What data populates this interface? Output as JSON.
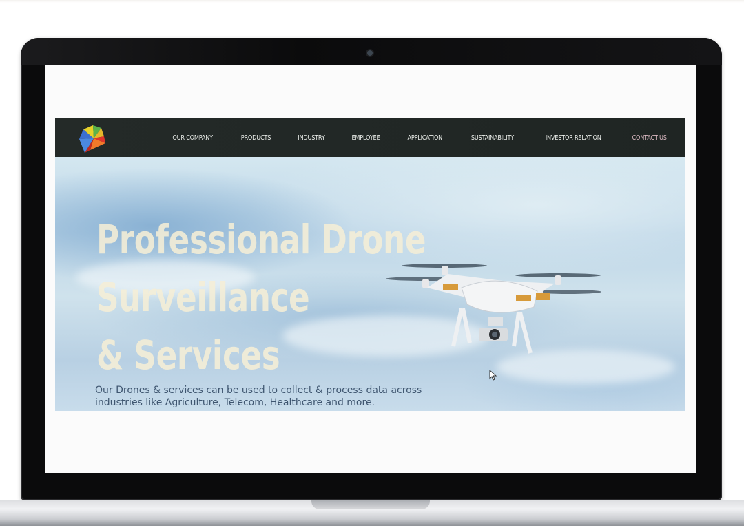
{
  "device": {
    "type": "laptop",
    "bezel_color": "#0b0b0c",
    "base_color": "#c9cbcf"
  },
  "website": {
    "logo_icon": "pinwheel-logo-icon",
    "nav": {
      "items": [
        {
          "label": "OUR COMPANY"
        },
        {
          "label": "PRODUCTS"
        },
        {
          "label": "INDUSTRY"
        },
        {
          "label": "EMPLOYEE"
        },
        {
          "label": "APPLICATION"
        },
        {
          "label": "SUSTAINABILITY"
        },
        {
          "label": "INVESTOR RELATION"
        },
        {
          "label": "CONTACT US"
        }
      ]
    },
    "hero": {
      "title_line_1": "Professional Drone",
      "title_line_2": "Surveillance",
      "title_line_3": "& Services",
      "subtitle_line_1": "Our Drones & services can be used to collect & process data across",
      "subtitle_line_2": "industries like Agriculture, Telecom, Healthcare and more.",
      "image": "quadcopter-drone-icon",
      "cursor_icon": "mouse-pointer-icon"
    },
    "colors": {
      "nav_bg": "#242a28",
      "nav_text": "#e9ece8",
      "title_text": "#f5eed6",
      "subtitle_text": "#3f5670",
      "sky": "#bcd5e7"
    }
  }
}
